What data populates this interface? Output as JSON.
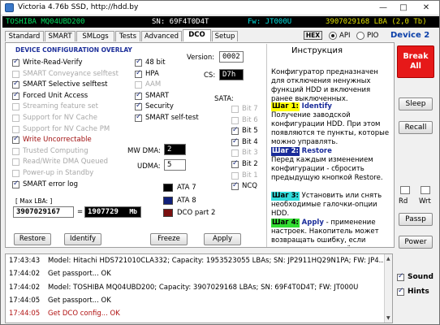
{
  "window": {
    "title": "Victoria 4.76b SSD, http://hdd.by",
    "minimize_glyph": "—",
    "maximize_glyph": "□",
    "close_glyph": "✕"
  },
  "infobar": {
    "model": "TOSHIBA MQ04UBD200",
    "serial": "SN: 69F4T0D4T",
    "firmware": "Fw: JT000U",
    "capacity": "3907029168 LBA (2,0 Tb)",
    "colors": {
      "model": "#00e060",
      "serial": "#ffffff",
      "firmware": "#00e0e0",
      "capacity": "#e0e000"
    }
  },
  "tabs": [
    "Standard",
    "SMART",
    "SMLogs",
    "Tests",
    "Advanced",
    "DCO",
    "Setup"
  ],
  "active_tab": "DCO",
  "header": {
    "hex_label": "HEX",
    "api_label": "API",
    "pio_label": "PIO",
    "api_selected": true,
    "device_label": "Device 2"
  },
  "dco": {
    "section_title": "DEVICE CONFIGURATION OVERLAY",
    "left_options": [
      {
        "label": "Write-Read-Verify",
        "checked": true,
        "enabled": true,
        "style": "normal"
      },
      {
        "label": "SMART Conveyance selftest",
        "checked": false,
        "enabled": false,
        "style": "normal"
      },
      {
        "label": "SMART Selective selftest",
        "checked": true,
        "enabled": true,
        "style": "normal"
      },
      {
        "label": "Forced Unit Access",
        "checked": true,
        "enabled": true,
        "style": "normal"
      },
      {
        "label": "Streaming feature set",
        "checked": false,
        "enabled": false,
        "style": "normal"
      },
      {
        "label": "Support for NV Cache",
        "checked": false,
        "enabled": false,
        "style": "normal"
      },
      {
        "label": "Support for NV Cache PM",
        "checked": false,
        "enabled": false,
        "style": "normal"
      },
      {
        "label": "Write Uncorrectable",
        "checked": true,
        "enabled": true,
        "style": "red"
      },
      {
        "label": "Trusted Computing",
        "checked": false,
        "enabled": false,
        "style": "normal"
      },
      {
        "label": "Read/Write DMA Queued",
        "checked": false,
        "enabled": false,
        "style": "normal"
      },
      {
        "label": "Power-up in Standby",
        "checked": false,
        "enabled": false,
        "style": "normal"
      },
      {
        "label": "SMART error log",
        "checked": true,
        "enabled": true,
        "style": "normal"
      }
    ],
    "mid_options": [
      {
        "label": "48 bit",
        "checked": true,
        "enabled": true
      },
      {
        "label": "HPA",
        "checked": true,
        "enabled": true
      },
      {
        "label": "AAM",
        "checked": false,
        "enabled": false
      },
      {
        "label": "SMART",
        "checked": true,
        "enabled": true
      },
      {
        "label": "Security",
        "checked": true,
        "enabled": true
      },
      {
        "label": "SMART self-test",
        "checked": true,
        "enabled": true
      }
    ],
    "version_label": "Version:",
    "version_value": "0002",
    "cs_label": "CS:",
    "cs_value": "D7h",
    "sata_label": "SATA:",
    "sata_options": [
      {
        "label": "Bit 7",
        "checked": false,
        "enabled": false
      },
      {
        "label": "Bit 6",
        "checked": false,
        "enabled": false
      },
      {
        "label": "Bit 5",
        "checked": true,
        "enabled": true
      },
      {
        "label": "Bit 4",
        "checked": true,
        "enabled": true
      },
      {
        "label": "Bit 3",
        "checked": false,
        "enabled": false
      },
      {
        "label": "Bit 2",
        "checked": true,
        "enabled": true
      },
      {
        "label": "Bit 1",
        "checked": false,
        "enabled": false
      },
      {
        "label": "NCQ",
        "checked": true,
        "enabled": true
      }
    ],
    "mw_dma_label": "MW DMA:",
    "mw_dma_value": "2",
    "udma_label": "UDMA:",
    "udma_value": "5",
    "ata_legend": [
      {
        "label": "ATA 7",
        "color": "#000000"
      },
      {
        "label": "ATA 8",
        "color": "#10207a"
      },
      {
        "label": "DCO part 2",
        "color": "#7a1010"
      }
    ],
    "max_lba_label": "[ Max LBA: ]",
    "max_lba_value": "3907029167",
    "equals": "=",
    "max_lba_mb": "1907729",
    "mb_unit": "Mb",
    "buttons": {
      "restore": "Restore",
      "identify": "Identify",
      "freeze": "Freeze",
      "apply": "Apply"
    }
  },
  "instructions": {
    "title": "Инструкция",
    "intro": "Конфигуратор предназначен для отключения ненужных функций HDD и включения ранее выключенных.",
    "steps": [
      {
        "tag": "Шаг 1:",
        "tag_bg": "#ffff00",
        "tag_fg": "#000000",
        "name": "Identify",
        "text": "Получение заводской конфигурации HDD. При этом появляются те пункты, которые можно управлять."
      },
      {
        "tag": "Шаг 2:",
        "tag_bg": "#1a2c9a",
        "tag_fg": "#ffffff",
        "name": "Restore",
        "text": "Перед каждым изменением конфигурации - сбросить предыдущую кнопкой Restore."
      },
      {
        "tag": "Шаг 3:",
        "tag_bg": "#33dddd",
        "tag_fg": "#000000",
        "name": "",
        "text": "Установить или снять необходимые галочки-опции HDD."
      },
      {
        "tag": "Шаг 4:",
        "tag_bg": "#33dd33",
        "tag_fg": "#000000",
        "name": "Apply",
        "text": "- применение настроек. Накопитель может возвращать ошибку, если применить не-изменённую"
      }
    ]
  },
  "side": {
    "break_all": "Break All",
    "sleep": "Sleep",
    "recall": "Recall",
    "rd": "Rd",
    "wrt": "Wrt",
    "passp": "Passp",
    "power": "Power"
  },
  "log": [
    {
      "time": "17:43:43",
      "text": "Model: Hitachi HDS721010CLA332; Capacity: 1953523055 LBAs; SN: JP2911HQ29N1PA; FW: JP4...",
      "color": "#000000"
    },
    {
      "time": "17:44:02",
      "text": "Get passport... OK",
      "color": "#000000"
    },
    {
      "time": "17:44:02",
      "text": "Model: TOSHIBA MQ04UBD200; Capacity: 3907029168 LBAs; SN: 69F4T0D4T; FW: JT000U",
      "color": "#000000"
    },
    {
      "time": "17:44:05",
      "text": "Get passport... OK",
      "color": "#000000"
    },
    {
      "time": "17:44:05",
      "text": "Get DCO config... OK",
      "color": "#b01010"
    }
  ],
  "options": {
    "sound_label": "Sound",
    "sound_checked": true,
    "hints_label": "Hints",
    "hints_checked": true
  }
}
